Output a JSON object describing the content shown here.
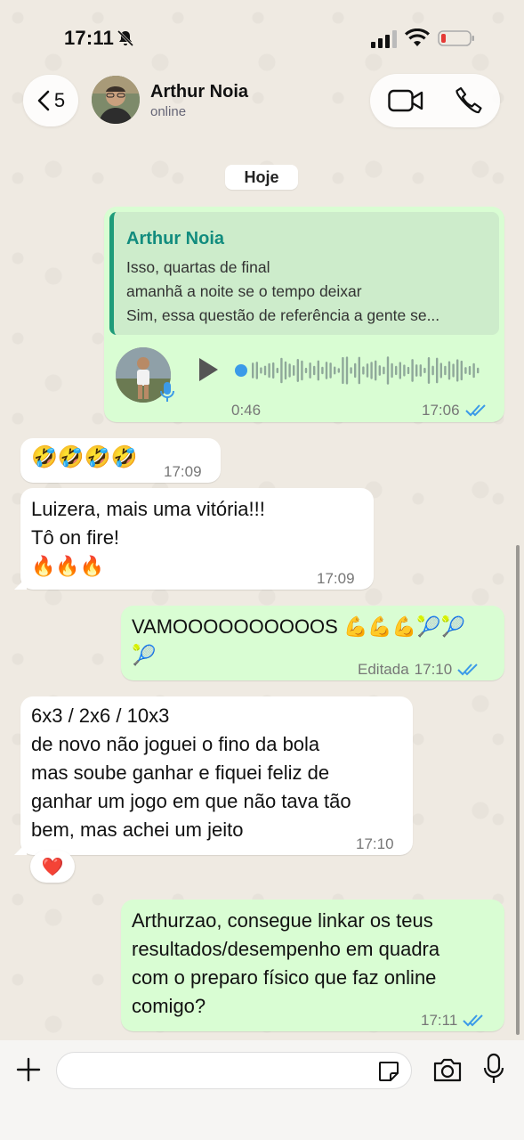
{
  "status_bar": {
    "time": "17:11"
  },
  "header": {
    "back_count": "5",
    "contact_name": "Arthur Noia",
    "contact_status": "online"
  },
  "chat": {
    "date_chip": "Hoje",
    "messages": [
      {
        "type": "voice",
        "direction": "outgoing",
        "quote": {
          "author": "Arthur Noia",
          "lines": [
            "Isso, quartas de final",
            "amanhã a noite se o tempo deixar",
            "Sim, essa questão de referência a gente se..."
          ]
        },
        "duration": "0:46",
        "time": "17:06",
        "read": true
      },
      {
        "type": "text",
        "direction": "incoming",
        "lines": [
          "🤣🤣🤣🤣"
        ],
        "time": "17:09"
      },
      {
        "type": "text",
        "direction": "incoming",
        "lines": [
          "Luizera, mais uma vitória!!!",
          "Tô on fire!",
          "🔥🔥🔥"
        ],
        "time": "17:09"
      },
      {
        "type": "text",
        "direction": "outgoing",
        "lines": [
          "VAMOOOOOOOOOOS 💪💪💪🎾🎾",
          "🎾"
        ],
        "edited_label": "Editada",
        "time": "17:10",
        "read": true
      },
      {
        "type": "text",
        "direction": "incoming",
        "lines": [
          "6x3 / 2x6 / 10x3",
          "de novo não joguei o fino da bola",
          "mas soube ganhar e fiquei feliz de",
          "ganhar um jogo em que não tava tão",
          "bem, mas achei um jeito"
        ],
        "time": "17:10",
        "reaction": "❤️"
      },
      {
        "type": "text",
        "direction": "outgoing",
        "lines": [
          "Arthurzao, consegue linkar os teus",
          "resultados/desempenho em quadra",
          "com o preparo físico que faz online",
          "comigo?"
        ],
        "time": "17:11",
        "read": true
      }
    ]
  },
  "composer": {
    "input_value": ""
  },
  "colors": {
    "outgoing_bubble": "#d9fdd3",
    "incoming_bubble": "#ffffff",
    "read_ticks": "#3b9ae8",
    "quote_bar": "#1f9c7a"
  }
}
